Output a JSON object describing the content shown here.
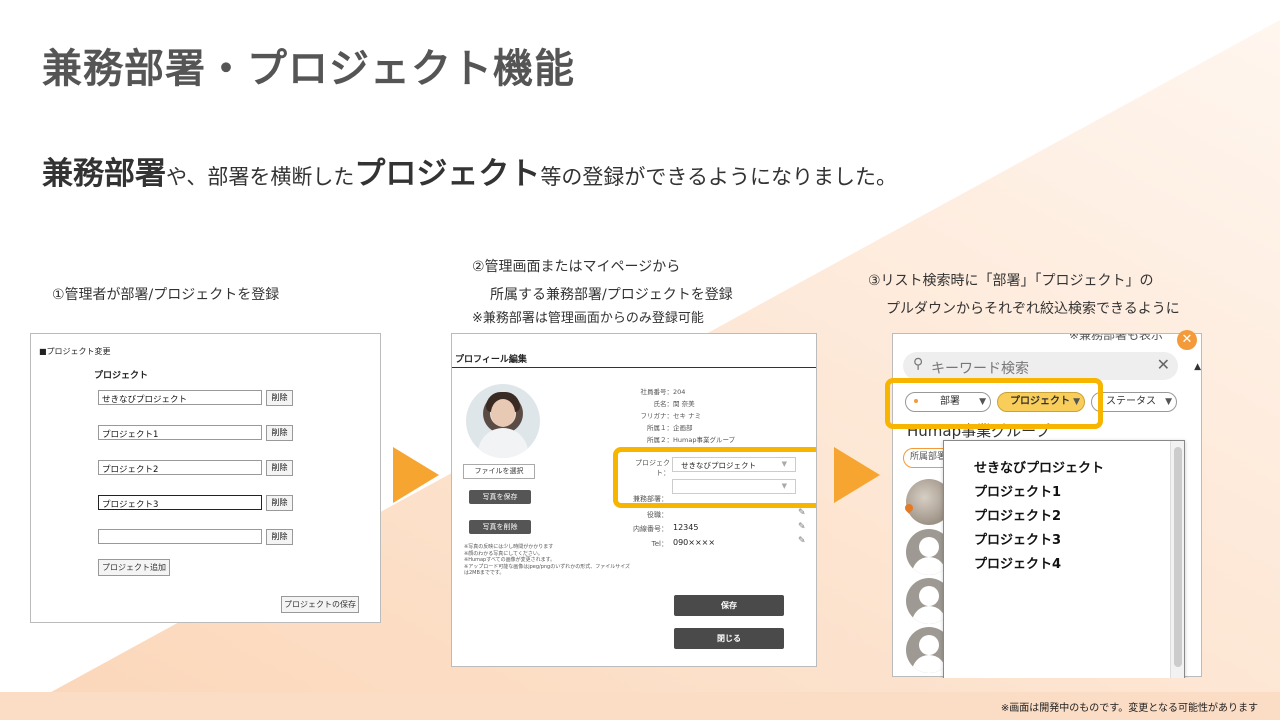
{
  "title": "兼務部署・プロジェクト機能",
  "subtitle": {
    "bold1": "兼務部署",
    "text1": "や、部署を横断した",
    "bold2": "プロジェクト",
    "text2": "等の登録ができるようになりました。"
  },
  "steps": {
    "s1": "①管理者が部署/プロジェクトを登録",
    "s2_line1": "②管理画面またはマイページから",
    "s2_line2": "所属する兼務部署/プロジェクトを登録",
    "s2_note": "※兼務部署は管理画面からのみ登録可能",
    "s3_line1": "③リスト検索時に「部署」「プロジェクト」の",
    "s3_line2": "プルダウンからそれぞれ絞込検索できるように"
  },
  "panel1": {
    "header": "■プロジェクト変更",
    "label": "プロジェクト",
    "projects": [
      "せきなびプロジェクト",
      "プロジェクト1",
      "プロジェクト2",
      "プロジェクト3",
      ""
    ],
    "delete_label": "削除",
    "add_label": "プロジェクト追加",
    "save_label": "プロジェクトの保存"
  },
  "panel2": {
    "header": "プロフィール編集",
    "file_button": "ファイルを選択",
    "save_photo": "写真を保存",
    "delete_photo": "写真を削除",
    "notes": [
      "※写真の反映には少し時間がかかります",
      "※顔のわかる写真にしてください。",
      "※Humapすべての画像が変更されます。",
      "※アップロード可能な画像はjpeg/pngのいずれかの形式、ファイルサイズは2MBまでです。"
    ],
    "info": [
      {
        "k": "社員番号：",
        "v": "204"
      },
      {
        "k": "氏名：",
        "v": "関 奈美"
      },
      {
        "k": "フリガナ：",
        "v": "セキ ナミ"
      },
      {
        "k": "所属１：",
        "v": "企画部"
      },
      {
        "k": "所属２：",
        "v": "Humap事業グループ"
      }
    ],
    "project_label": "プロジェクト：",
    "project_value": "せきなびプロジェクト",
    "second_label": "兼務部署：",
    "role_label": "役職：",
    "ext_label": "内線番号：",
    "ext_value": "12345",
    "tel_label": "Tel：",
    "tel_value": "090××××",
    "save_button": "保存",
    "close_button": "閉じる"
  },
  "panel3": {
    "search_placeholder": "キーワード検索",
    "chips": {
      "dept": "部署",
      "project": "プロジェクト",
      "status": "ステータス"
    },
    "group_name": "Humap事業グループ",
    "tag": "所属部署",
    "cut_text": "※兼務部署も表示",
    "options": [
      "せきなびプロジェクト",
      "プロジェクト1",
      "プロジェクト2",
      "プロジェクト3",
      "プロジェクト4"
    ]
  },
  "footer_note": "※画面は開発中のものです。変更となる可能性があります",
  "colors": {
    "accent": "#f7a531",
    "highlight": "#f7b500",
    "chip_active": "#f9cd5a"
  }
}
